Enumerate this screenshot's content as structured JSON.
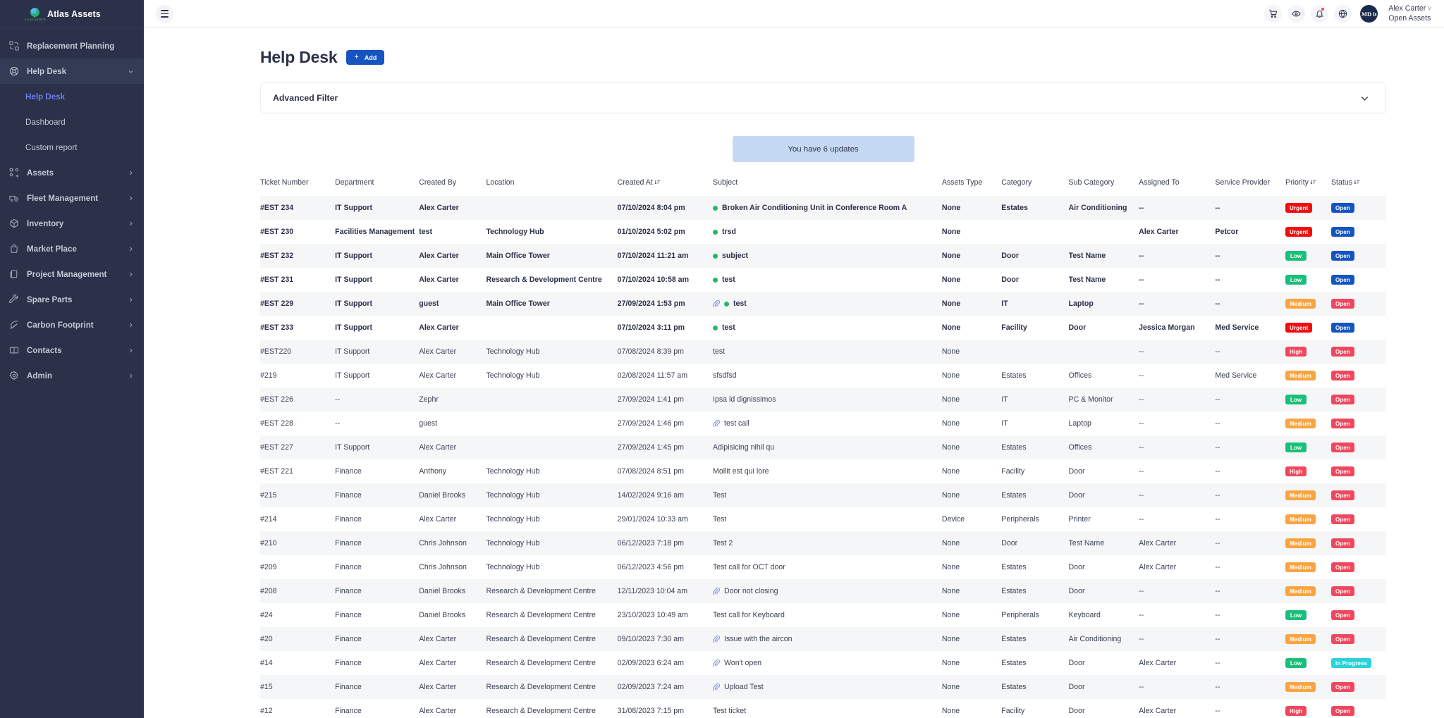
{
  "brand": {
    "name": "Atlas Assets",
    "logo_sub": "ATLAS ASSETS"
  },
  "sidebar": {
    "items": [
      {
        "label": "Replacement Planning",
        "icon": "replacement-planning-icon",
        "chevron": "",
        "state": ""
      },
      {
        "label": "Help Desk",
        "icon": "lifebuoy-icon",
        "chevron": "down",
        "state": "expanded"
      },
      {
        "label": "Assets",
        "icon": "assets-icon",
        "chevron": "right",
        "state": ""
      },
      {
        "label": "Fleet Management",
        "icon": "truck-icon",
        "chevron": "right",
        "state": ""
      },
      {
        "label": "Inventory",
        "icon": "box-icon",
        "chevron": "right",
        "state": ""
      },
      {
        "label": "Market Place",
        "icon": "bag-icon",
        "chevron": "right",
        "state": ""
      },
      {
        "label": "Project Management",
        "icon": "layers-icon",
        "chevron": "right",
        "state": ""
      },
      {
        "label": "Spare Parts",
        "icon": "wrench-icon",
        "chevron": "right",
        "state": ""
      },
      {
        "label": "Carbon Footprint",
        "icon": "leaf-icon",
        "chevron": "right",
        "state": ""
      },
      {
        "label": "Contacts",
        "icon": "book-icon",
        "chevron": "right",
        "state": ""
      },
      {
        "label": "Admin",
        "icon": "gear-icon",
        "chevron": "right",
        "state": ""
      }
    ],
    "submenu": [
      {
        "label": "Help Desk",
        "current": true
      },
      {
        "label": "Dashboard",
        "current": false
      },
      {
        "label": "Custom report",
        "current": false
      }
    ]
  },
  "topbar": {
    "icons": [
      "cart-icon",
      "eye-icon",
      "bell-icon",
      "globe-icon"
    ],
    "avatar_initials": "MD it",
    "user_name": "Alex Carter",
    "user_org": "Open Assets"
  },
  "page": {
    "title": "Help Desk",
    "add_label": "Add",
    "add_plus": "+",
    "filter_title": "Advanced Filter",
    "updates_text": "You have 6 updates"
  },
  "table": {
    "headers": [
      {
        "label": "Ticket Number",
        "sort": false
      },
      {
        "label": "Department",
        "sort": false
      },
      {
        "label": "Created By",
        "sort": false
      },
      {
        "label": "Location",
        "sort": false
      },
      {
        "label": "Created At",
        "sort": true
      },
      {
        "label": "Subject",
        "sort": false
      },
      {
        "label": "Assets Type",
        "sort": false
      },
      {
        "label": "Category",
        "sort": false
      },
      {
        "label": "Sub Category",
        "sort": false
      },
      {
        "label": "Assigned To",
        "sort": false
      },
      {
        "label": "Service Provider",
        "sort": false
      },
      {
        "label": "Priority",
        "sort": true
      },
      {
        "label": "Status",
        "sort": true
      }
    ],
    "rows": [
      {
        "ticket": "#EST 234",
        "department": "IT Support",
        "created_by": "Alex Carter",
        "location": "",
        "created_at": "07/10/2024 8:04 pm",
        "clip": false,
        "dot": true,
        "subject": "Broken Air Conditioning Unit in Conference Room A",
        "assets_type": "None",
        "category": "Estates",
        "sub_category": "Air Conditioning",
        "assigned_to": "--",
        "service_provider": "--",
        "priority": "Urgent",
        "priority_class": "b-urgent",
        "status": "Open",
        "status_class": "b-open-b",
        "unread": true
      },
      {
        "ticket": "#EST 230",
        "department": "Facilities Management",
        "created_by": "test",
        "location": "Technology Hub",
        "created_at": "01/10/2024 5:02 pm",
        "clip": false,
        "dot": true,
        "subject": "trsd",
        "assets_type": "None",
        "category": "",
        "sub_category": "",
        "assigned_to": "Alex Carter",
        "service_provider": "Petcor",
        "priority": "Urgent",
        "priority_class": "b-urgent",
        "status": "Open",
        "status_class": "b-open-b",
        "unread": true
      },
      {
        "ticket": "#EST 232",
        "department": "IT Support",
        "created_by": "Alex Carter",
        "location": "Main Office Tower",
        "created_at": "07/10/2024 11:21 am",
        "clip": false,
        "dot": true,
        "subject": "subject",
        "assets_type": "None",
        "category": "Door",
        "sub_category": "Test Name",
        "assigned_to": "--",
        "service_provider": "--",
        "priority": "Low",
        "priority_class": "b-low",
        "status": "Open",
        "status_class": "b-open-b",
        "unread": true
      },
      {
        "ticket": "#EST 231",
        "department": "IT Support",
        "created_by": "Alex Carter",
        "location": "Research & Development Centre",
        "created_at": "07/10/2024 10:58 am",
        "clip": false,
        "dot": true,
        "subject": "test",
        "assets_type": "None",
        "category": "Door",
        "sub_category": "Test Name",
        "assigned_to": "--",
        "service_provider": "--",
        "priority": "Low",
        "priority_class": "b-low",
        "status": "Open",
        "status_class": "b-open-b",
        "unread": true
      },
      {
        "ticket": "#EST 229",
        "department": "IT Support",
        "created_by": "guest",
        "location": "Main Office Tower",
        "created_at": "27/09/2024 1:53 pm",
        "clip": true,
        "dot": true,
        "subject": "test",
        "assets_type": "None",
        "category": "IT",
        "sub_category": "Laptop",
        "assigned_to": "--",
        "service_provider": "--",
        "priority": "Medium",
        "priority_class": "b-medium",
        "status": "Open",
        "status_class": "b-open-r",
        "unread": true
      },
      {
        "ticket": "#EST 233",
        "department": "IT Support",
        "created_by": "Alex Carter",
        "location": "",
        "created_at": "07/10/2024 3:11 pm",
        "clip": false,
        "dot": true,
        "subject": "test",
        "assets_type": "None",
        "category": "Facility",
        "sub_category": "Door",
        "assigned_to": "Jessica Morgan",
        "service_provider": "Med Service",
        "priority": "Urgent",
        "priority_class": "b-urgent",
        "status": "Open",
        "status_class": "b-open-b",
        "unread": true
      },
      {
        "ticket": "#EST220",
        "department": "IT Support",
        "created_by": "Alex Carter",
        "location": "Technology Hub",
        "created_at": "07/08/2024 8:39 pm",
        "clip": false,
        "dot": false,
        "subject": "test",
        "assets_type": "None",
        "category": "",
        "sub_category": "",
        "assigned_to": "--",
        "service_provider": "--",
        "priority": "High",
        "priority_class": "b-high",
        "status": "Open",
        "status_class": "b-open-r",
        "unread": false
      },
      {
        "ticket": "#219",
        "department": "IT Support",
        "created_by": "Alex Carter",
        "location": "Technology Hub",
        "created_at": "02/08/2024 11:57 am",
        "clip": false,
        "dot": false,
        "subject": "sfsdfsd",
        "assets_type": "None",
        "category": "Estates",
        "sub_category": "Offices",
        "assigned_to": "--",
        "service_provider": "Med Service",
        "priority": "Medium",
        "priority_class": "b-medium",
        "status": "Open",
        "status_class": "b-open-r",
        "unread": false
      },
      {
        "ticket": "#EST 226",
        "department": "--",
        "created_by": "Zephr",
        "location": "",
        "created_at": "27/09/2024 1:41 pm",
        "clip": false,
        "dot": false,
        "subject": "Ipsa id dignissimos",
        "assets_type": "None",
        "category": "IT",
        "sub_category": "PC & Monitor",
        "assigned_to": "--",
        "service_provider": "--",
        "priority": "Low",
        "priority_class": "b-low",
        "status": "Open",
        "status_class": "b-open-r",
        "unread": false
      },
      {
        "ticket": "#EST 228",
        "department": "--",
        "created_by": "guest",
        "location": "",
        "created_at": "27/09/2024 1:46 pm",
        "clip": true,
        "dot": false,
        "subject": "test call",
        "assets_type": "None",
        "category": "IT",
        "sub_category": "Laptop",
        "assigned_to": "--",
        "service_provider": "--",
        "priority": "Medium",
        "priority_class": "b-medium",
        "status": "Open",
        "status_class": "b-open-r",
        "unread": false
      },
      {
        "ticket": "#EST 227",
        "department": "IT Support",
        "created_by": "Alex Carter",
        "location": "",
        "created_at": "27/09/2024 1:45 pm",
        "clip": false,
        "dot": false,
        "subject": "Adipisicing nihil qu",
        "assets_type": "None",
        "category": "Estates",
        "sub_category": "Offices",
        "assigned_to": "--",
        "service_provider": "--",
        "priority": "Low",
        "priority_class": "b-low",
        "status": "Open",
        "status_class": "b-open-r",
        "unread": false
      },
      {
        "ticket": "#EST 221",
        "department": "Finance",
        "created_by": "Anthony",
        "location": "Technology Hub",
        "created_at": "07/08/2024 8:51 pm",
        "clip": false,
        "dot": false,
        "subject": "Mollit est qui lore",
        "assets_type": "None",
        "category": "Facility",
        "sub_category": "Door",
        "assigned_to": "--",
        "service_provider": "--",
        "priority": "High",
        "priority_class": "b-high",
        "status": "Open",
        "status_class": "b-open-r",
        "unread": false
      },
      {
        "ticket": "#215",
        "department": "Finance",
        "created_by": "Daniel Brooks",
        "location": "Technology Hub",
        "created_at": "14/02/2024 9:16 am",
        "clip": false,
        "dot": false,
        "subject": "Test",
        "assets_type": "None",
        "category": "Estates",
        "sub_category": "Door",
        "assigned_to": "--",
        "service_provider": "--",
        "priority": "Medium",
        "priority_class": "b-medium",
        "status": "Open",
        "status_class": "b-open-r",
        "unread": false
      },
      {
        "ticket": "#214",
        "department": "Finance",
        "created_by": "Alex Carter",
        "location": "Technology Hub",
        "created_at": "29/01/2024 10:33 am",
        "clip": false,
        "dot": false,
        "subject": "Test",
        "assets_type": "Device",
        "category": "Peripherals",
        "sub_category": "Printer",
        "assigned_to": "--",
        "service_provider": "--",
        "priority": "Medium",
        "priority_class": "b-medium",
        "status": "Open",
        "status_class": "b-open-r",
        "unread": false
      },
      {
        "ticket": "#210",
        "department": "Finance",
        "created_by": "Chris Johnson",
        "location": "Technology Hub",
        "created_at": "06/12/2023 7:18 pm",
        "clip": false,
        "dot": false,
        "subject": "Test 2",
        "assets_type": "None",
        "category": "Door",
        "sub_category": "Test Name",
        "assigned_to": "Alex Carter",
        "service_provider": "--",
        "priority": "Medium",
        "priority_class": "b-medium",
        "status": "Open",
        "status_class": "b-open-r",
        "unread": false
      },
      {
        "ticket": "#209",
        "department": "Finance",
        "created_by": "Chris Johnson",
        "location": "Technology Hub",
        "created_at": "06/12/2023 4:56 pm",
        "clip": false,
        "dot": false,
        "subject": "Test call for OCT door",
        "assets_type": "None",
        "category": "Estates",
        "sub_category": "Door",
        "assigned_to": "Alex Carter",
        "service_provider": "--",
        "priority": "Medium",
        "priority_class": "b-medium",
        "status": "Open",
        "status_class": "b-open-r",
        "unread": false
      },
      {
        "ticket": "#208",
        "department": "Finance",
        "created_by": "Daniel Brooks",
        "location": "Research & Development Centre",
        "created_at": "12/11/2023 10:04 am",
        "clip": true,
        "dot": false,
        "subject": "Door not closing",
        "assets_type": "None",
        "category": "Estates",
        "sub_category": "Door",
        "assigned_to": "--",
        "service_provider": "--",
        "priority": "Medium",
        "priority_class": "b-medium",
        "status": "Open",
        "status_class": "b-open-r",
        "unread": false
      },
      {
        "ticket": "#24",
        "department": "Finance",
        "created_by": "Daniel Brooks",
        "location": "Research & Development Centre",
        "created_at": "23/10/2023 10:49 am",
        "clip": false,
        "dot": false,
        "subject": "Test call for Keyboard",
        "assets_type": "None",
        "category": "Peripherals",
        "sub_category": "Keyboard",
        "assigned_to": "--",
        "service_provider": "--",
        "priority": "Low",
        "priority_class": "b-low",
        "status": "Open",
        "status_class": "b-open-r",
        "unread": false
      },
      {
        "ticket": "#20",
        "department": "Finance",
        "created_by": "Alex Carter",
        "location": "Research & Development Centre",
        "created_at": "09/10/2023 7:30 am",
        "clip": true,
        "dot": false,
        "subject": "Issue with the aircon",
        "assets_type": "None",
        "category": "Estates",
        "sub_category": "Air Conditioning",
        "assigned_to": "--",
        "service_provider": "--",
        "priority": "Medium",
        "priority_class": "b-medium",
        "status": "Open",
        "status_class": "b-open-r",
        "unread": false
      },
      {
        "ticket": "#14",
        "department": "Finance",
        "created_by": "Alex Carter",
        "location": "Research & Development Centre",
        "created_at": "02/09/2023 6:24 am",
        "clip": true,
        "dot": false,
        "subject": "Won't open",
        "assets_type": "None",
        "category": "Estates",
        "sub_category": "Door",
        "assigned_to": "Alex Carter",
        "service_provider": "--",
        "priority": "Low",
        "priority_class": "b-low",
        "status": "In Progress",
        "status_class": "b-progress",
        "unread": false
      },
      {
        "ticket": "#15",
        "department": "Finance",
        "created_by": "Alex Carter",
        "location": "Research & Development Centre",
        "created_at": "02/09/2023 7:24 am",
        "clip": true,
        "dot": false,
        "subject": "Upload Test",
        "assets_type": "None",
        "category": "Estates",
        "sub_category": "Door",
        "assigned_to": "--",
        "service_provider": "--",
        "priority": "Medium",
        "priority_class": "b-medium",
        "status": "Open",
        "status_class": "b-open-r",
        "unread": false
      },
      {
        "ticket": "#12",
        "department": "Finance",
        "created_by": "Alex Carter",
        "location": "Research & Development Centre",
        "created_at": "31/08/2023 7:15 pm",
        "clip": false,
        "dot": false,
        "subject": "Test ticket",
        "assets_type": "None",
        "category": "Facility",
        "sub_category": "Door",
        "assigned_to": "Alex Carter",
        "service_provider": "--",
        "priority": "High",
        "priority_class": "b-high",
        "status": "Open",
        "status_class": "b-open-r",
        "unread": false
      }
    ]
  },
  "colors": {
    "sidebar_bg": "#2b3148",
    "accent_blue": "#1455c1",
    "link_blue": "#6b7cf6",
    "urgent": "#f40d10",
    "high": "#f0475e",
    "medium": "#f8a541",
    "low": "#1bbf7b",
    "in_progress": "#2ad2da",
    "updates_bg": "#c5daf2",
    "green_dot": "#27b36b"
  }
}
